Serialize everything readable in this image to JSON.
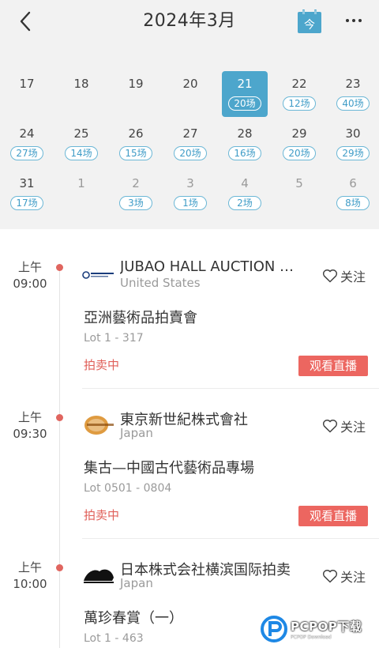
{
  "header": {
    "title": "2024年3月",
    "today_label": "今"
  },
  "calendar": {
    "days": [
      {
        "num": "17",
        "count": ""
      },
      {
        "num": "18",
        "count": ""
      },
      {
        "num": "19",
        "count": ""
      },
      {
        "num": "20",
        "count": ""
      },
      {
        "num": "21",
        "count": "20场"
      },
      {
        "num": "22",
        "count": "12场"
      },
      {
        "num": "23",
        "count": "40场"
      },
      {
        "num": "24",
        "count": "27场"
      },
      {
        "num": "25",
        "count": "14场"
      },
      {
        "num": "26",
        "count": "15场"
      },
      {
        "num": "27",
        "count": "20场"
      },
      {
        "num": "28",
        "count": "16场"
      },
      {
        "num": "29",
        "count": "20场"
      },
      {
        "num": "30",
        "count": "29场"
      },
      {
        "num": "31",
        "count": "17场"
      },
      {
        "num": "1",
        "count": ""
      },
      {
        "num": "2",
        "count": "3场"
      },
      {
        "num": "3",
        "count": "1场"
      },
      {
        "num": "4",
        "count": "2场"
      },
      {
        "num": "5",
        "count": ""
      },
      {
        "num": "6",
        "count": "8场"
      }
    ]
  },
  "auctions": [
    {
      "period": "上午",
      "time": "09:00",
      "house": "JUBAO HALL AUCTION …",
      "country": "United States",
      "sale": "亞洲藝術品拍賣會",
      "lot": "Lot 1 - 317",
      "status": "拍卖中",
      "follow": "关注",
      "live": "观看直播"
    },
    {
      "period": "上午",
      "time": "09:30",
      "house": "東京新世紀株式會社",
      "country": "Japan",
      "sale": "集古—中國古代藝術品專場",
      "lot": "Lot 0501 - 0804",
      "status": "拍卖中",
      "follow": "关注",
      "live": "观看直播"
    },
    {
      "period": "上午",
      "time": "10:00",
      "house": "日本株式会社横滨国际拍卖",
      "country": "Japan",
      "sale": "萬珍春賞（一）",
      "lot": "Lot 1 - 463",
      "follow": "关注"
    }
  ],
  "watermark": {
    "main": "PCPOP下载",
    "sub": "PCPOP Download"
  },
  "colors": {
    "accent": "#4da6cc",
    "live": "#ec6660",
    "status": "#e0605a",
    "dot": "#e0655f"
  }
}
